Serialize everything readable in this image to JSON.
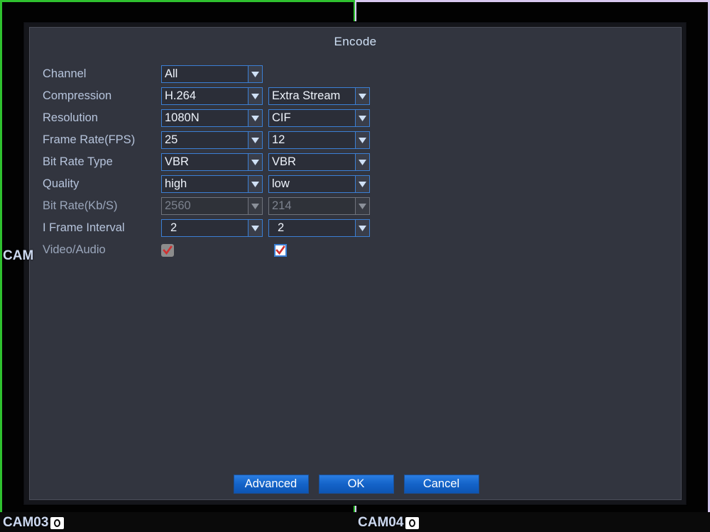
{
  "video_wall": {
    "panes": [
      {
        "id": "cam03",
        "label": "CAM03",
        "icon": "camera-icon",
        "border_color": "#2fc12f"
      },
      {
        "id": "cam04",
        "label": "CAM04",
        "icon": "camera-icon",
        "border_color": "#d8c8f0"
      }
    ],
    "clipped_osd_label": "CAM"
  },
  "dialog": {
    "title": "Encode",
    "colors": {
      "panel_bg": "#32353f",
      "accent_border": "#3b7fd4",
      "button_blue": "#1463c8",
      "label_text": "#b6c4dc",
      "check_red": "#d03030"
    },
    "rows": [
      {
        "label": "Channel",
        "main": {
          "type": "combo",
          "value": "All",
          "enabled": true,
          "align": "left"
        },
        "extra": null
      },
      {
        "label": "Compression",
        "main": {
          "type": "combo",
          "value": "H.264",
          "enabled": true,
          "align": "left"
        },
        "extra": {
          "type": "combo",
          "value": "Extra Stream",
          "enabled": true,
          "align": "left"
        }
      },
      {
        "label": "Resolution",
        "main": {
          "type": "combo",
          "value": "1080N",
          "enabled": true,
          "align": "left"
        },
        "extra": {
          "type": "combo",
          "value": "CIF",
          "enabled": true,
          "align": "left"
        }
      },
      {
        "label": "Frame Rate(FPS)",
        "main": {
          "type": "combo",
          "value": "25",
          "enabled": true,
          "align": "left"
        },
        "extra": {
          "type": "combo",
          "value": "12",
          "enabled": true,
          "align": "left"
        }
      },
      {
        "label": "Bit Rate Type",
        "main": {
          "type": "combo",
          "value": "VBR",
          "enabled": true,
          "align": "left"
        },
        "extra": {
          "type": "combo",
          "value": "VBR",
          "enabled": true,
          "align": "left"
        }
      },
      {
        "label": "Quality",
        "main": {
          "type": "combo",
          "value": "high",
          "enabled": true,
          "align": "left"
        },
        "extra": {
          "type": "combo",
          "value": "low",
          "enabled": true,
          "align": "left"
        }
      },
      {
        "label": "Bit Rate(Kb/S)",
        "main": {
          "type": "combo",
          "value": "2560",
          "enabled": false,
          "align": "left"
        },
        "extra": {
          "type": "combo",
          "value": "214",
          "enabled": false,
          "align": "left"
        }
      },
      {
        "label": "I Frame Interval",
        "main": {
          "type": "combo",
          "value": "2",
          "enabled": true,
          "align": "center"
        },
        "extra": {
          "type": "combo",
          "value": "2",
          "enabled": true,
          "align": "center"
        }
      },
      {
        "label": "Video/Audio",
        "main": {
          "type": "checkbox",
          "checked": true,
          "enabled": false
        },
        "extra": {
          "type": "checkbox",
          "checked": true,
          "enabled": true
        }
      }
    ],
    "buttons": [
      {
        "name": "advanced",
        "label": "Advanced"
      },
      {
        "name": "ok",
        "label": "OK"
      },
      {
        "name": "cancel",
        "label": "Cancel"
      }
    ]
  }
}
